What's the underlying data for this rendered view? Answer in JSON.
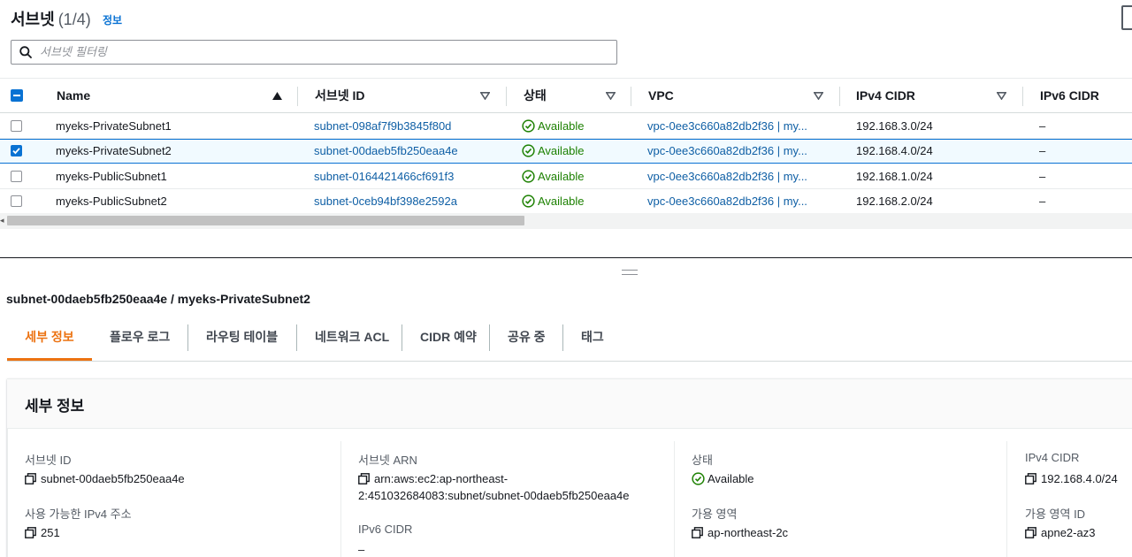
{
  "header": {
    "title": "서브넷",
    "count": "(1/4)",
    "info_link": "정보"
  },
  "search": {
    "placeholder": "서브넷 필터링",
    "value": ""
  },
  "table": {
    "columns": [
      {
        "label": "Name",
        "sort": "ascending"
      },
      {
        "label": "서브넷 ID",
        "sort": "none"
      },
      {
        "label": "상태",
        "sort": "none"
      },
      {
        "label": "VPC",
        "sort": "none"
      },
      {
        "label": "IPv4 CIDR",
        "sort": "none"
      },
      {
        "label": "IPv6 CIDR",
        "sort": "none"
      }
    ],
    "rows": [
      {
        "selected": false,
        "name": "myeks-PrivateSubnet1",
        "subnet_id": "subnet-098af7f9b3845f80d",
        "status": "Available",
        "vpc": "vpc-0ee3c660a82db2f36 | my...",
        "ipv4": "192.168.3.0/24",
        "ipv6": "–"
      },
      {
        "selected": true,
        "name": "myeks-PrivateSubnet2",
        "subnet_id": "subnet-00daeb5fb250eaa4e",
        "status": "Available",
        "vpc": "vpc-0ee3c660a82db2f36 | my...",
        "ipv4": "192.168.4.0/24",
        "ipv6": "–"
      },
      {
        "selected": false,
        "name": "myeks-PublicSubnet1",
        "subnet_id": "subnet-0164421466cf691f3",
        "status": "Available",
        "vpc": "vpc-0ee3c660a82db2f36 | my...",
        "ipv4": "192.168.1.0/24",
        "ipv6": "–"
      },
      {
        "selected": false,
        "name": "myeks-PublicSubnet2",
        "subnet_id": "subnet-0ceb94bf398e2592a",
        "status": "Available",
        "vpc": "vpc-0ee3c660a82db2f36 | my...",
        "ipv4": "192.168.2.0/24",
        "ipv6": "–"
      }
    ]
  },
  "detail": {
    "title": "subnet-00daeb5fb250eaa4e / myeks-PrivateSubnet2",
    "tabs": [
      "세부 정보",
      "플로우 로그",
      "라우팅 테이블",
      "네트워크 ACL",
      "CIDR 예약",
      "공유 중",
      "태그"
    ],
    "active_tab": 0,
    "panel_title": "세부 정보",
    "fields": {
      "subnet_id": {
        "label": "서브넷 ID",
        "value": "subnet-00daeb5fb250eaa4e"
      },
      "available_ipv4": {
        "label": "사용 가능한 IPv4 주소",
        "value": "251"
      },
      "subnet_arn": {
        "label": "서브넷 ARN",
        "value_line1": "arn:aws:ec2:ap-northeast-",
        "value_line2": "2:451032684083:subnet/subnet-00daeb5fb250eaa4e"
      },
      "ipv6_cidr": {
        "label": "IPv6 CIDR",
        "value": "–"
      },
      "state": {
        "label": "상태",
        "value": "Available"
      },
      "az": {
        "label": "가용 영역",
        "value": "ap-northeast-2c"
      },
      "ipv4_cidr": {
        "label": "IPv4 CIDR",
        "value": "192.168.4.0/24"
      },
      "az_id": {
        "label": "가용 영역 ID",
        "value": "apne2-az3"
      }
    }
  },
  "colors": {
    "accent": "#0972d3",
    "link": "#0f5fa5",
    "success": "#1d8102",
    "active_tab": "#ec7211"
  },
  "icons": [
    "search-icon",
    "sort-ascending-icon",
    "sort-icon",
    "check-circle-icon",
    "copy-icon",
    "drag-handle-icon"
  ]
}
